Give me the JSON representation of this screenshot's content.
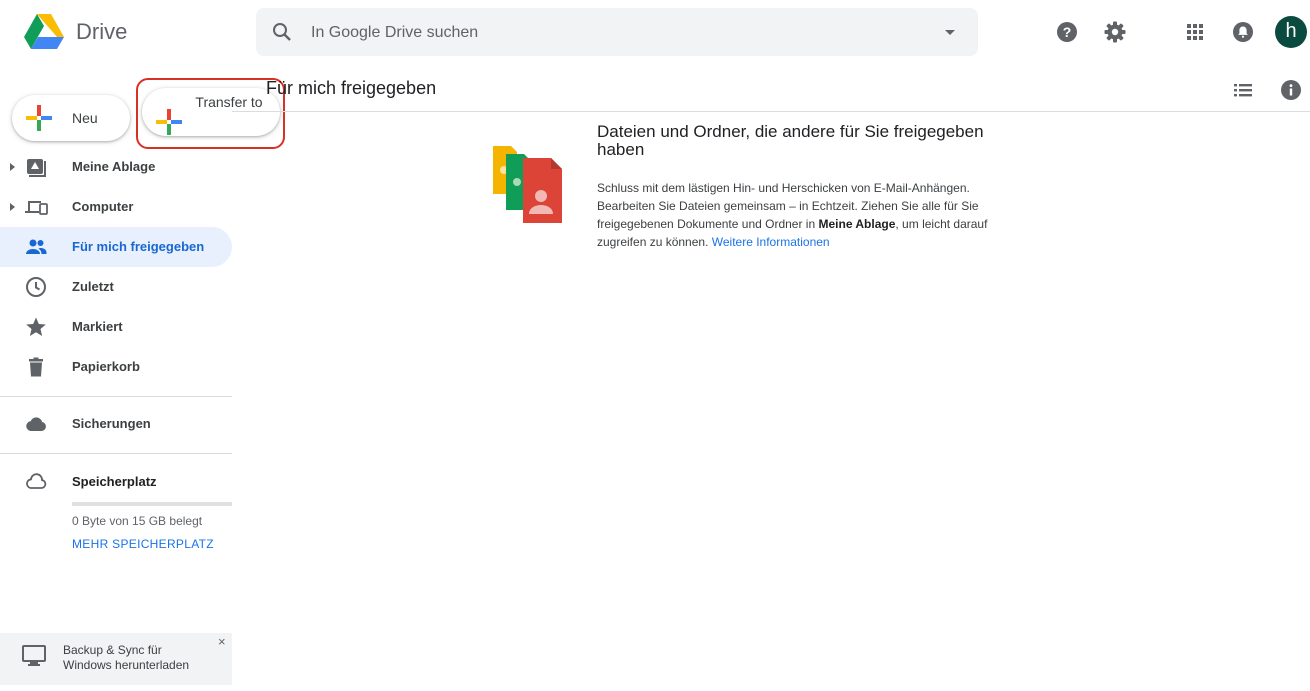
{
  "app": {
    "name": "Drive"
  },
  "search": {
    "placeholder": "In Google Drive suchen"
  },
  "header": {
    "avatar_letter": "h"
  },
  "buttons": {
    "new_label": "Neu",
    "transfer_label": "Transfer to"
  },
  "page": {
    "title": "Für mich freigegeben"
  },
  "sidebar": {
    "items": [
      {
        "label": "Meine Ablage",
        "icon": "drive-icon"
      },
      {
        "label": "Computer",
        "icon": "computer-icon"
      },
      {
        "label": "Für mich freigegeben",
        "icon": "shared-people-icon",
        "active": true
      },
      {
        "label": "Zuletzt",
        "icon": "clock-icon"
      },
      {
        "label": "Markiert",
        "icon": "star-icon"
      },
      {
        "label": "Papierkorb",
        "icon": "trash-icon"
      }
    ],
    "backups": {
      "label": "Sicherungen",
      "icon": "cloud-icon"
    },
    "storage": {
      "label": "Speicherplatz",
      "used_text": "0 Byte von 15 GB belegt",
      "used_fraction": 0,
      "more_label": "MEHR SPEICHERPLATZ"
    }
  },
  "empty_state": {
    "title": "Dateien und Ordner, die andere für Sie freigegeben haben",
    "body_part1": "Schluss mit dem lästigen Hin- und Herschicken von E-Mail-Anhängen. Bearbeiten Sie Dateien gemeinsam – in Echtzeit. Ziehen Sie alle für Sie freigegebenen Dokumente und Ordner in ",
    "body_bold": "Meine Ablage",
    "body_part2": ", um leicht darauf zugreifen zu können. ",
    "link_label": "Weitere Informationen"
  },
  "banner": {
    "text": "Backup & Sync für Windows herunterladen",
    "close_label": "×"
  },
  "colors": {
    "accent": "#1a73e8",
    "active_bg": "#e8f0fe",
    "highlight_border": "#d93025",
    "avatar_bg": "#0b4b3f"
  }
}
